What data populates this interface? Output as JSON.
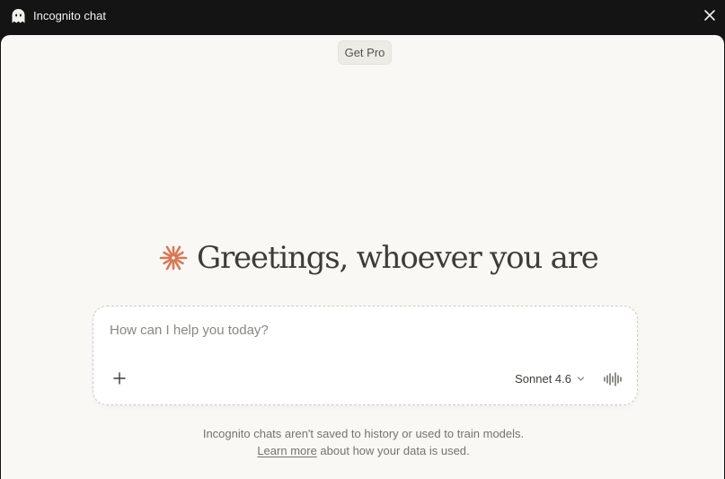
{
  "titlebar": {
    "title": "Incognito chat",
    "ghost_icon": "ghost-icon",
    "close_icon": "close-icon"
  },
  "header": {
    "get_pro_label": "Get Pro"
  },
  "greeting": {
    "text": "Greetings, whoever you are",
    "icon": "spark-icon",
    "icon_color": "#d97757"
  },
  "composer": {
    "placeholder": "How can I help you today?",
    "value": "",
    "add_icon": "plus-icon",
    "model_label": "Sonnet 4.6",
    "model_icon": "chevron-down-icon",
    "voice_icon": "voice-waveform-icon"
  },
  "footer": {
    "line1": "Incognito chats aren't saved to history or used to train models.",
    "learn_more": "Learn more",
    "line2_rest": " about how your data is used."
  },
  "colors": {
    "titlebar_bg": "#141414",
    "page_bg": "#f9f8f5",
    "accent": "#d97757"
  }
}
